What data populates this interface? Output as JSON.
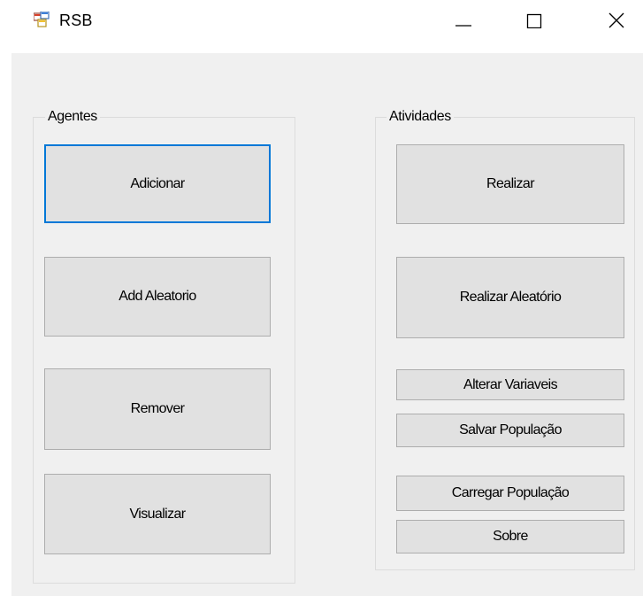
{
  "window": {
    "title": "RSB",
    "icon": "app-window-icon",
    "controls": {
      "minimize_icon": "minimize-icon",
      "maximize_icon": "maximize-icon",
      "close_icon": "close-icon"
    }
  },
  "agentes": {
    "legend": "Agentes",
    "buttons": {
      "adicionar": "Adicionar",
      "add_aleatorio": "Add Aleatorio",
      "remover": "Remover",
      "visualizar": "Visualizar"
    }
  },
  "atividades": {
    "legend": "Atividades",
    "buttons": {
      "realizar": "Realizar",
      "realizar_aleatorio": "Realizar Aleatório",
      "alterar_variaveis": "Alterar Variaveis",
      "salvar_populacao": "Salvar População",
      "carregar_populacao": "Carregar População",
      "sobre": "Sobre"
    }
  },
  "colors": {
    "client_background": "#f0f0f0",
    "button_face": "#e1e1e1",
    "button_border": "#adadad",
    "focus_border": "#0078d7",
    "group_border": "#dcdcdc"
  }
}
